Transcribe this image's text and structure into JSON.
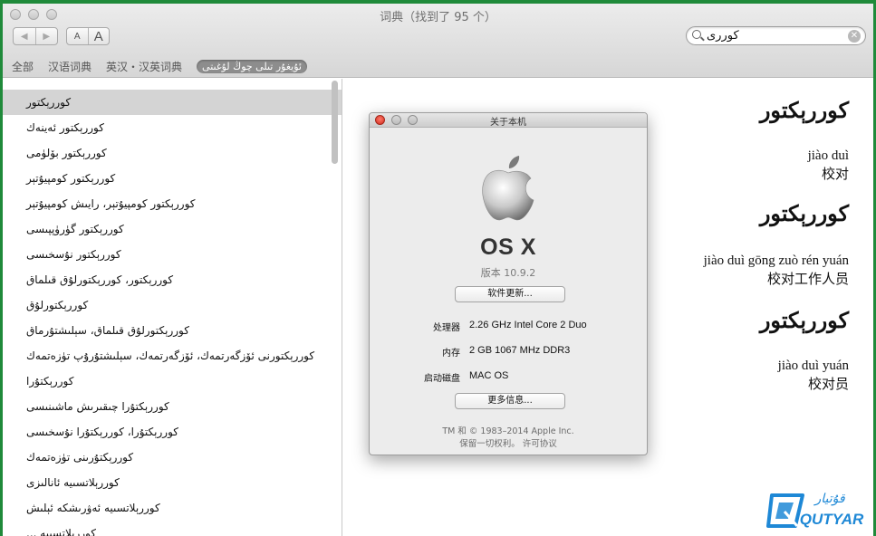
{
  "window": {
    "title": "词典（找到了 95 个）"
  },
  "toolbar": {
    "back_icon": "◀",
    "forward_icon": "▶",
    "font_small": "A",
    "font_large": "A",
    "search_value": "كوررى"
  },
  "scope": {
    "tabs": [
      "全部",
      "汉语词典",
      "英汉・汉英词典"
    ],
    "selected": "ئۇيغۇر تىلى چوڭ لۇغىتى"
  },
  "sidebar": {
    "items": [
      "كوررېكتور",
      "كوررېكتور ئەينەك",
      "كوررېكتور بۆلۈمى",
      "كوررېكتور كومپيۇتېر",
      "كوررېكتور كومپيۇتېر، رايىش كومپيۇتېر",
      "كوررېكتور گۈرۈپپىسى",
      "كوررېكتور نۇسخىسى",
      "كوررېكتور، كوررېكتورلۇق قىلماق",
      "كوررېكتورلۇق",
      "كوررېكتورلۇق قىلماق، سېلىشتۇرماق",
      "كوررېكتورنى ئۆزگەرتمەك، ئۆزگەرتمەك، سېلىشتۇرۇپ تۈزەتمەك",
      "كوررېكتۇرا",
      "كوررېكتۇرا چىقىرىش ماشىنىسى",
      "كوررېكتۇرا، كوررېكتۇرا نۇسخىسى",
      "كوررېكتۇرىنى تۈزەتمەك",
      "كوررېلاتسىيە ئانالىزى",
      "كوررېلاتسىيە ئەۋرىشكە ئېلىش",
      "كوررېلاتسىيە ... "
    ]
  },
  "entries": [
    {
      "headword": "كوررېكتور",
      "pinyin": "jiào duì",
      "hanzi": "校对"
    },
    {
      "headword": "كوررېكتور",
      "pinyin": "jiào duì gōng zuò rén yuán",
      "hanzi": "校对工作人员"
    },
    {
      "headword": "كوررېكتور",
      "pinyin": "jiào duì yuán",
      "hanzi": "校对员"
    }
  ],
  "about": {
    "title": "关于本机",
    "os_name": "OS X",
    "version": "版本 10.9.2",
    "update_button": "软件更新...",
    "processor_label": "处理器",
    "processor_value": "2.26 GHz Intel Core 2 Duo",
    "memory_label": "内存",
    "memory_value": "2 GB 1067 MHz DDR3",
    "disk_label": "启动磁盘",
    "disk_value": "MAC OS",
    "more_button": "更多信息...",
    "copyright_line1": "TM 和 © 1983–2014 Apple Inc.",
    "copyright_line2": "保留一切权利。  许可协议"
  },
  "watermark": {
    "script_text": "قۇتيار",
    "latin_text": "QUTYAR"
  },
  "colors": {
    "frame": "#1f8a3a",
    "logo_blue": "#1e88d6"
  }
}
